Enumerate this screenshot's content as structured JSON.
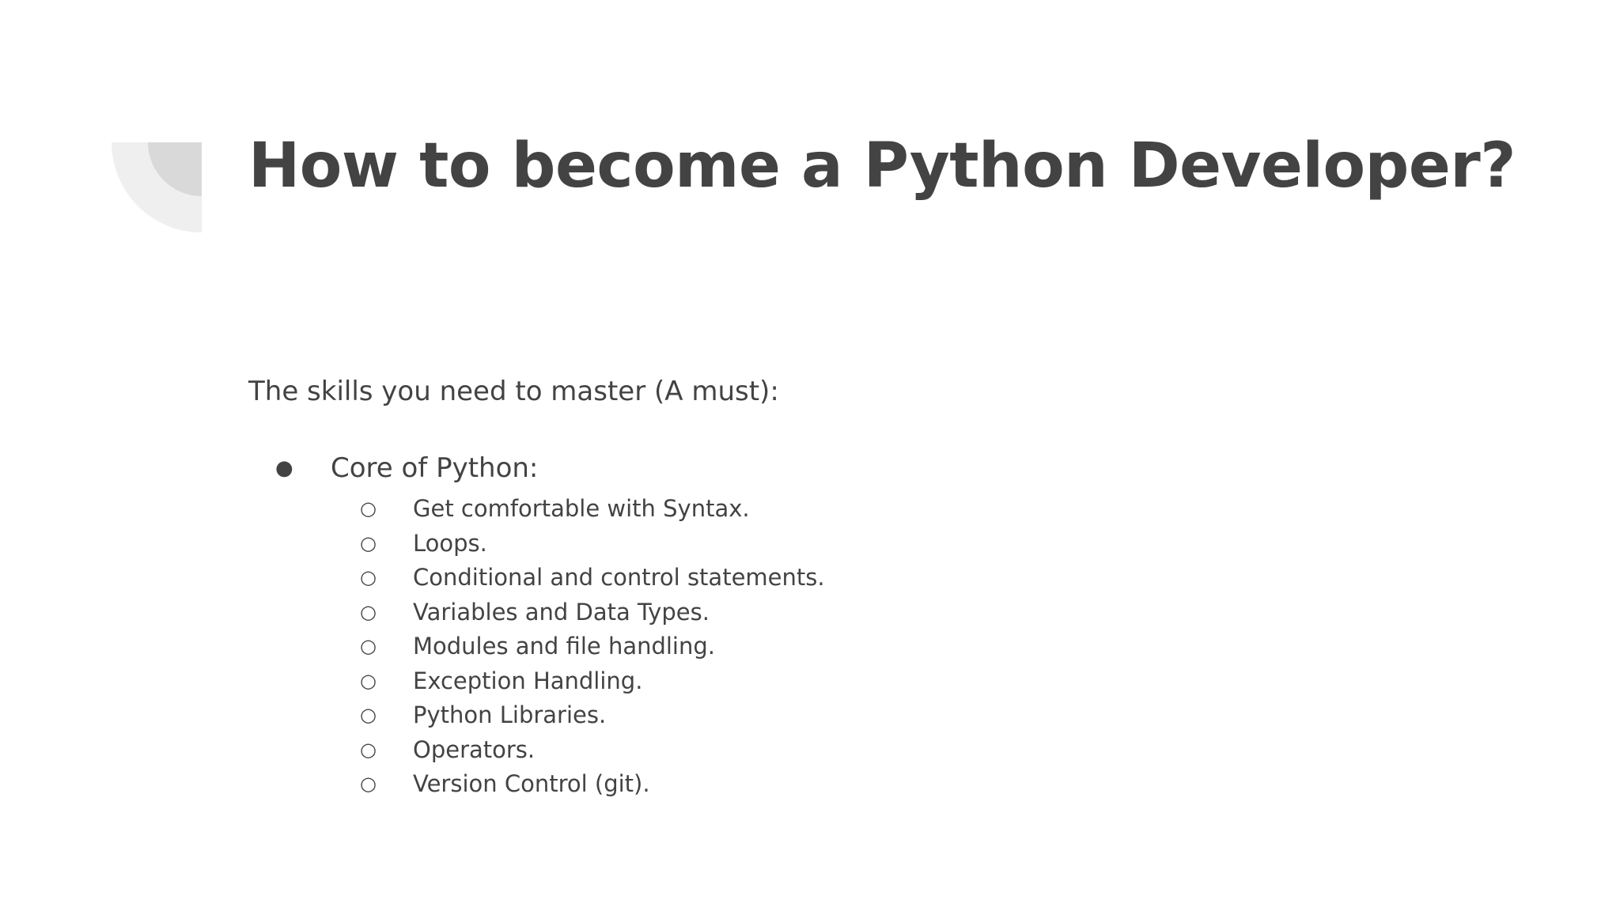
{
  "slide": {
    "title": "How to become a Python Developer?",
    "intro": "The skills you need to master (A must):",
    "main_bullet": "Core of Python:",
    "level1_bullet_symbol": "●",
    "level2_bullet_symbol": "○",
    "sub_items": [
      "Get comfortable with Syntax.",
      "Loops.",
      "Conditional and control statements.",
      "Variables and Data Types.",
      "Modules and file handling.",
      "Exception Handling.",
      "Python Libraries.",
      "Operators.",
      "Version Control (git)."
    ]
  },
  "colors": {
    "text": "#434343",
    "background": "#ffffff",
    "decoration_outer": "#efefef",
    "decoration_inner": "#d9d9d9"
  },
  "icons": {
    "corner_decoration": "quarter-circle-decoration"
  }
}
